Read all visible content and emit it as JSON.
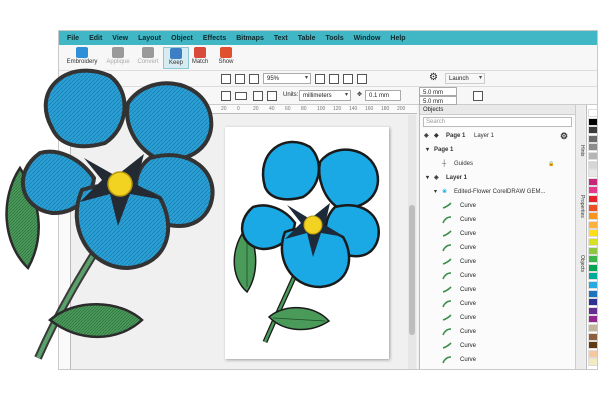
{
  "menu": [
    "File",
    "Edit",
    "View",
    "Layout",
    "Object",
    "Effects",
    "Bitmaps",
    "Text",
    "Table",
    "Tools",
    "Window",
    "Help"
  ],
  "toolbar": {
    "buttons": [
      {
        "label": "Embroidery",
        "icon": "embroidery-icon",
        "color": "#2f8fd8",
        "enabled": true
      },
      {
        "label": "Applique",
        "icon": "applique-icon",
        "color": "#9a9a9a",
        "enabled": false
      },
      {
        "label": "Convert",
        "icon": "convert-icon",
        "color": "#9a9a9a",
        "enabled": false
      },
      {
        "label": "Keep",
        "icon": "keep-icon",
        "color": "#3d7fc5",
        "enabled": true,
        "active": true
      },
      {
        "label": "Match",
        "icon": "match-icon",
        "color": "#d84a3a",
        "enabled": true
      },
      {
        "label": "Show",
        "icon": "show-icon",
        "color": "#e0502f",
        "enabled": true
      }
    ]
  },
  "standard_bar": {
    "zoom": "95%",
    "launch": "Launch"
  },
  "property_bar": {
    "units_label": "Units:",
    "units_value": "millimeters",
    "nudge": "0.1 mm",
    "dup_x": "5.0 mm",
    "dup_y": "5.0 mm"
  },
  "ruler_numbers": [
    "20",
    "0",
    "20",
    "40",
    "60",
    "80",
    "100",
    "120",
    "140",
    "160",
    "180",
    "200"
  ],
  "docker": {
    "title": "Objects",
    "search_placeholder": "Search",
    "page_label": "Page 1",
    "layer_label": "Layer 1",
    "tree": {
      "page": "Page 1",
      "guides": "Guides",
      "layer": "Layer 1",
      "group": "Edited-Flower CorelDRAW GEM...",
      "curves": [
        "Curve",
        "Curve",
        "Curve",
        "Curve",
        "Curve",
        "Curve",
        "Curve",
        "Curve",
        "Curve",
        "Curve",
        "Curve",
        "Curve"
      ]
    }
  },
  "side_tabs": [
    "Hints",
    "Properties",
    "Objects"
  ],
  "palette": [
    "#ffffff",
    "#000000",
    "#3a3a3a",
    "#6b6b6b",
    "#8c8c8c",
    "#b5b5b5",
    "#d6d6d6",
    "#e8e8e8",
    "#c7247a",
    "#e53a8c",
    "#e8212b",
    "#f04e23",
    "#f7941d",
    "#fbb040",
    "#ffde17",
    "#d7e021",
    "#8dc63f",
    "#39b54a",
    "#00a651",
    "#00a99d",
    "#27aae1",
    "#1c75bc",
    "#2e3192",
    "#662d91",
    "#92278f",
    "#c2b59b",
    "#8b5e3c",
    "#603913",
    "#f7c8a0",
    "#f3eabf"
  ],
  "colors": {
    "menubar": "#41b6c4",
    "petal": "#1aa9e4",
    "emb_petal": "#2aa0d6",
    "leaf": "#4a9a5a",
    "center": "#f3d321"
  }
}
